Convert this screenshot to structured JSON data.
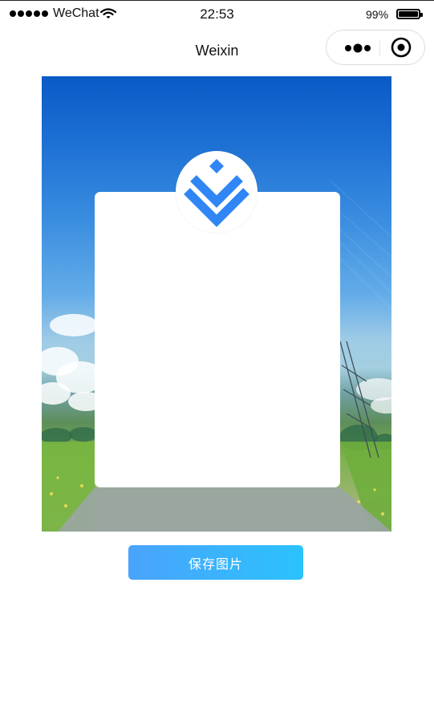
{
  "status_bar": {
    "carrier": "WeChat",
    "time": "22:53",
    "battery_percent": "99%",
    "battery_level": 0.99,
    "signal_icon": "signal-dots-icon",
    "wifi_icon": "wifi-icon",
    "battery_icon": "battery-icon"
  },
  "nav": {
    "title": "Weixin",
    "more_icon": "more-dots-icon",
    "close_icon": "target-close-icon"
  },
  "poster": {
    "logo_icon": "chevron-diamond-logo-icon",
    "logo_color": "#2f86f4"
  },
  "actions": {
    "save_label": "保存图片"
  }
}
